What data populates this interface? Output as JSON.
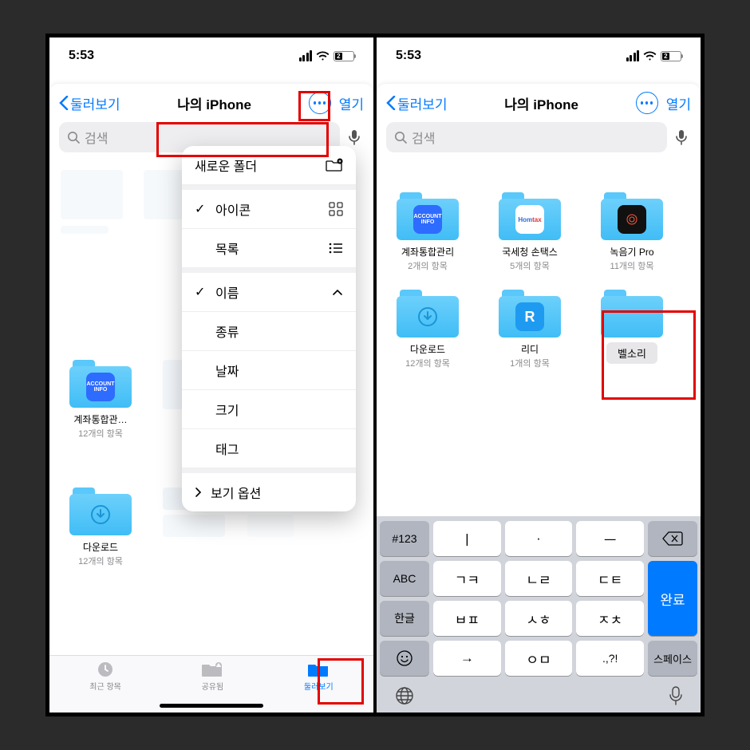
{
  "status": {
    "time": "5:53",
    "battery_text": "2"
  },
  "nav": {
    "back": "둘러보기",
    "title": "나의 iPhone",
    "open": "열기"
  },
  "search": {
    "placeholder": "검색"
  },
  "menu": {
    "new_folder": "새로운 폴더",
    "icon_view": "아이콘",
    "list_view": "목록",
    "sort_name": "이름",
    "sort_kind": "종류",
    "sort_date": "날짜",
    "sort_size": "크기",
    "sort_tag": "태그",
    "view_options": "보기 옵션"
  },
  "left_folders": {
    "f1": {
      "name": "계좌통합관…",
      "count": "12개의 항목",
      "badge": "ACCOUNT\nINFO"
    },
    "f2": {
      "name": "다운로드",
      "count": "12개의 항목"
    }
  },
  "right_folders": {
    "f1": {
      "name": "계좌통합관리",
      "count": "2개의 항목",
      "badge": "ACCOUNT\nINFO"
    },
    "f2": {
      "name": "국세청 손택스",
      "count": "5개의 항목"
    },
    "f3": {
      "name": "녹음기 Pro",
      "count": "11개의 항목"
    },
    "f4": {
      "name": "다운로드",
      "count": "12개의 항목"
    },
    "f5": {
      "name": "리디",
      "count": "1개의 항목"
    },
    "f6": {
      "name": "벨소리",
      "count": ""
    }
  },
  "tabs": {
    "recents": "최근 항목",
    "shared": "공유됨",
    "browse": "둘러보기"
  },
  "keyboard": {
    "num": "#123",
    "abc": "ABC",
    "hangul": "한글",
    "r1a": "ㅣ",
    "r1b": "·",
    "r1c": "ㅡ",
    "r2a": "ㄱㅋ",
    "r2b": "ㄴㄹ",
    "r2c": "ㄷㅌ",
    "r3a": "ㅂㅍ",
    "r3b": "ㅅㅎ",
    "r3c": "ㅈㅊ",
    "r4a": "→",
    "r4b": "ㅇㅁ",
    "r4c": ".,?!",
    "done": "완료",
    "space": "스페이스"
  }
}
